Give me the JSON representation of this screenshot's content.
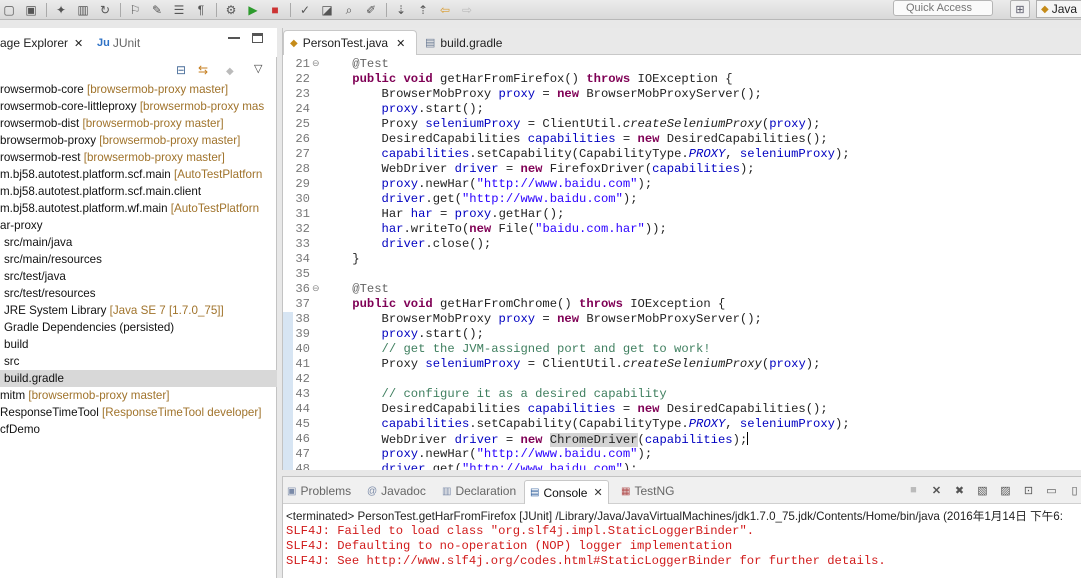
{
  "toolbar": {
    "quick_access_placeholder": "Quick Access",
    "perspective_label": "Java",
    "icons": [
      "new-icon",
      "save-icon",
      "debug-icon",
      "sdk-icon",
      "run-config-icon",
      "build-icon",
      "marker-icon",
      "list-icon",
      "gear-icon",
      "run-icon",
      "stop-icon",
      "tasks-icon",
      "open-type-icon",
      "search-icon",
      "annotation-icon",
      "next-annotation-icon",
      "prev-annotation-icon",
      "back-icon",
      "forward-icon"
    ]
  },
  "package_explorer": {
    "tab_label": "age Explorer",
    "junit_tab_label": "JUnit",
    "tree": [
      {
        "label": "rowsermob-core",
        "annotation": "[browsermob-proxy master]"
      },
      {
        "label": "rowsermob-core-littleproxy",
        "annotation": "[browsermob-proxy mas"
      },
      {
        "label": "rowsermob-dist",
        "annotation": "[browsermob-proxy master]"
      },
      {
        "label": "browsermob-proxy",
        "annotation": "[browsermob-proxy master]"
      },
      {
        "label": "rowsermob-rest",
        "annotation": "[browsermob-proxy master]"
      },
      {
        "label": "m.bj58.autotest.platform.scf.main",
        "annotation": "[AutoTestPlatforn"
      },
      {
        "label": "m.bj58.autotest.platform.scf.main.client",
        "annotation": ""
      },
      {
        "label": "m.bj58.autotest.platform.wf.main",
        "annotation": "[AutoTestPlatforn"
      },
      {
        "label": "ar-proxy",
        "annotation": ""
      },
      {
        "label": "src/main/java",
        "annotation": ""
      },
      {
        "label": "src/main/resources",
        "annotation": ""
      },
      {
        "label": "src/test/java",
        "annotation": ""
      },
      {
        "label": "src/test/resources",
        "annotation": ""
      },
      {
        "label": "JRE System Library",
        "annotation": "[Java SE 7 [1.7.0_75]]"
      },
      {
        "label": "Gradle Dependencies (persisted)",
        "annotation": ""
      },
      {
        "label": "build",
        "annotation": ""
      },
      {
        "label": "src",
        "annotation": ""
      },
      {
        "label": "build.gradle",
        "annotation": ""
      },
      {
        "label": "mitm",
        "annotation": "[browsermob-proxy master]"
      },
      {
        "label": "ResponseTimeTool",
        "annotation": "[ResponseTimeTool developer]"
      },
      {
        "label": "cfDemo",
        "annotation": ""
      }
    ]
  },
  "editor": {
    "tabs": [
      {
        "label": "PersonTest.java",
        "active": true
      },
      {
        "label": "build.gradle",
        "active": false
      }
    ],
    "lines": [
      {
        "n": "21",
        "fold": "⊖",
        "tokens": [
          [
            "an",
            "    @Test"
          ]
        ]
      },
      {
        "n": "22",
        "fold": "",
        "tokens": [
          [
            "kw",
            "    public void "
          ],
          [
            "",
            "getHarFromFirefox() "
          ],
          [
            "kw",
            "throws "
          ],
          [
            "",
            "IOException {"
          ]
        ]
      },
      {
        "n": "23",
        "fold": "",
        "tokens": [
          [
            "",
            "        BrowserMobProxy "
          ],
          [
            "fld",
            "proxy"
          ],
          [
            "",
            " = "
          ],
          [
            "kw",
            "new "
          ],
          [
            "",
            "BrowserMobProxyServer();"
          ]
        ]
      },
      {
        "n": "24",
        "fold": "",
        "tokens": [
          [
            "fld",
            "        proxy"
          ],
          [
            "",
            ".start();"
          ]
        ]
      },
      {
        "n": "25",
        "fold": "",
        "tokens": [
          [
            "",
            "        Proxy "
          ],
          [
            "fld",
            "seleniumProxy"
          ],
          [
            "",
            " = ClientUtil."
          ],
          [
            "stm",
            "createSeleniumProxy"
          ],
          [
            "",
            "("
          ],
          [
            "fld",
            "proxy"
          ],
          [
            "",
            ");"
          ]
        ]
      },
      {
        "n": "26",
        "fold": "",
        "tokens": [
          [
            "",
            "        DesiredCapabilities "
          ],
          [
            "fld",
            "capabilities"
          ],
          [
            "",
            " = "
          ],
          [
            "kw",
            "new "
          ],
          [
            "",
            "DesiredCapabilities();"
          ]
        ]
      },
      {
        "n": "27",
        "fold": "",
        "tokens": [
          [
            "fld",
            "        capabilities"
          ],
          [
            "",
            ".setCapability(CapabilityType."
          ],
          [
            "st",
            "PROXY"
          ],
          [
            "",
            ", "
          ],
          [
            "fld",
            "seleniumProxy"
          ],
          [
            "",
            ");"
          ]
        ]
      },
      {
        "n": "28",
        "fold": "",
        "tokens": [
          [
            "",
            "        WebDriver "
          ],
          [
            "fld",
            "driver"
          ],
          [
            "",
            " = "
          ],
          [
            "kw",
            "new "
          ],
          [
            "",
            "FirefoxDriver("
          ],
          [
            "fld",
            "capabilities"
          ],
          [
            "",
            ");"
          ]
        ]
      },
      {
        "n": "29",
        "fold": "",
        "tokens": [
          [
            "fld",
            "        proxy"
          ],
          [
            "",
            ".newHar("
          ],
          [
            "str",
            "\"http://www.baidu.com\""
          ],
          [
            "",
            ");"
          ]
        ]
      },
      {
        "n": "30",
        "fold": "",
        "tokens": [
          [
            "fld",
            "        driver"
          ],
          [
            "",
            ".get("
          ],
          [
            "str",
            "\"http://www.baidu.com\""
          ],
          [
            "",
            ");"
          ]
        ]
      },
      {
        "n": "31",
        "fold": "",
        "tokens": [
          [
            "",
            "        Har "
          ],
          [
            "fld",
            "har"
          ],
          [
            "",
            " = "
          ],
          [
            "fld",
            "proxy"
          ],
          [
            "",
            ".getHar();"
          ]
        ]
      },
      {
        "n": "32",
        "fold": "",
        "tokens": [
          [
            "fld",
            "        har"
          ],
          [
            "",
            ".writeTo("
          ],
          [
            "kw",
            "new "
          ],
          [
            "",
            "File("
          ],
          [
            "str",
            "\"baidu.com.har\""
          ],
          [
            "",
            "));"
          ]
        ]
      },
      {
        "n": "33",
        "fold": "",
        "tokens": [
          [
            "fld",
            "        driver"
          ],
          [
            "",
            ".close();"
          ]
        ]
      },
      {
        "n": "34",
        "fold": "",
        "tokens": [
          [
            "",
            "    }"
          ]
        ]
      },
      {
        "n": "35",
        "fold": "",
        "tokens": [
          [
            "",
            ""
          ]
        ]
      },
      {
        "n": "36",
        "fold": "⊖",
        "tokens": [
          [
            "an",
            "    @Test"
          ]
        ]
      },
      {
        "n": "37",
        "fold": "",
        "tokens": [
          [
            "kw",
            "    public void "
          ],
          [
            "",
            "getHarFromChrome() "
          ],
          [
            "kw",
            "throws "
          ],
          [
            "",
            "IOException {"
          ]
        ]
      },
      {
        "n": "38",
        "fold": "",
        "tokens": [
          [
            "",
            "        BrowserMobProxy "
          ],
          [
            "fld",
            "proxy"
          ],
          [
            "",
            " = "
          ],
          [
            "kw",
            "new "
          ],
          [
            "",
            "BrowserMobProxyServer();"
          ]
        ]
      },
      {
        "n": "39",
        "fold": "",
        "tokens": [
          [
            "fld",
            "        proxy"
          ],
          [
            "",
            ".start();"
          ]
        ]
      },
      {
        "n": "40",
        "fold": "",
        "tokens": [
          [
            "cm",
            "        // get the JVM-assigned port and get to work!"
          ]
        ]
      },
      {
        "n": "41",
        "fold": "",
        "tokens": [
          [
            "",
            "        Proxy "
          ],
          [
            "fld",
            "seleniumProxy"
          ],
          [
            "",
            " = ClientUtil."
          ],
          [
            "stm",
            "createSeleniumProxy"
          ],
          [
            "",
            "("
          ],
          [
            "fld",
            "proxy"
          ],
          [
            "",
            ");"
          ]
        ]
      },
      {
        "n": "42",
        "fold": "",
        "tokens": [
          [
            "",
            ""
          ]
        ]
      },
      {
        "n": "43",
        "fold": "",
        "tokens": [
          [
            "cm",
            "        // configure it as a desired capability"
          ]
        ]
      },
      {
        "n": "44",
        "fold": "",
        "tokens": [
          [
            "",
            "        DesiredCapabilities "
          ],
          [
            "fld",
            "capabilities"
          ],
          [
            "",
            " = "
          ],
          [
            "kw",
            "new "
          ],
          [
            "",
            "DesiredCapabilities();"
          ]
        ]
      },
      {
        "n": "45",
        "fold": "",
        "tokens": [
          [
            "fld",
            "        capabilities"
          ],
          [
            "",
            ".setCapability(CapabilityType."
          ],
          [
            "st",
            "PROXY"
          ],
          [
            "",
            ", "
          ],
          [
            "fld",
            "seleniumProxy"
          ],
          [
            "",
            ");"
          ]
        ]
      },
      {
        "n": "46",
        "fold": "",
        "tokens": [
          [
            "",
            "        WebDriver "
          ],
          [
            "fld",
            "driver"
          ],
          [
            "",
            " = "
          ],
          [
            "kw",
            "new "
          ],
          [
            "hl",
            "ChromeDriver"
          ],
          [
            "",
            "("
          ],
          [
            "fld",
            "capabilities"
          ],
          [
            "",
            ");"
          ],
          [
            "caret",
            ""
          ]
        ]
      },
      {
        "n": "47",
        "fold": "",
        "tokens": [
          [
            "fld",
            "        proxy"
          ],
          [
            "",
            ".newHar("
          ],
          [
            "str",
            "\"http://www.baidu.com\""
          ],
          [
            "",
            ");"
          ]
        ]
      },
      {
        "n": "48",
        "fold": "",
        "tokens": [
          [
            "fld",
            "        driver"
          ],
          [
            "",
            ".get("
          ],
          [
            "str",
            "\"http://www.baidu.com\""
          ],
          [
            "",
            ");"
          ]
        ]
      }
    ]
  },
  "bottom": {
    "tabs": [
      {
        "label": "Problems",
        "icon": "problems-icon",
        "active": false
      },
      {
        "label": "Javadoc",
        "icon": "javadoc-icon",
        "active": false
      },
      {
        "label": "Declaration",
        "icon": "declaration-icon",
        "active": false
      },
      {
        "label": "Console",
        "icon": "console-icon",
        "active": true
      },
      {
        "label": "TestNG",
        "icon": "testng-icon",
        "active": false
      }
    ],
    "console_status": "<terminated> PersonTest.getHarFromFirefox [JUnit] /Library/Java/JavaVirtualMachines/jdk1.7.0_75.jdk/Contents/Home/bin/java (2016年1月14日 下午6:",
    "console_lines": [
      "SLF4J: Failed to load class \"org.slf4j.impl.StaticLoggerBinder\".",
      "SLF4J: Defaulting to no-operation (NOP) logger implementation",
      "SLF4J: See http://www.slf4j.org/codes.html#StaticLoggerBinder for further details."
    ]
  }
}
